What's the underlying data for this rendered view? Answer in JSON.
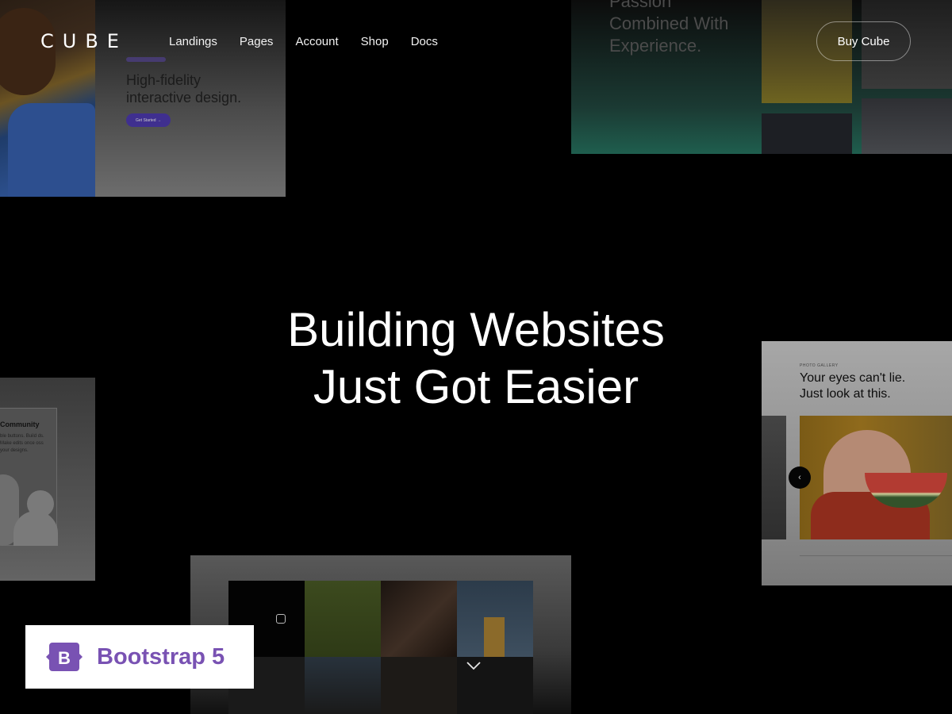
{
  "brand": {
    "logo_text": "CUBE"
  },
  "nav": {
    "links": [
      "Landings",
      "Pages",
      "Account",
      "Shop",
      "Docs"
    ],
    "cta_label": "Buy Cube"
  },
  "hero": {
    "line1": "Building Websites",
    "line2": "Just Got Easier"
  },
  "tiles": {
    "top_left": {
      "headline_1": "High-fidelity",
      "headline_2": "interactive design.",
      "button": "Get Started  →"
    },
    "top_right": {
      "line1": "Passion",
      "line2": "Combined With",
      "line3": "Experience."
    },
    "left_middle": {
      "title": "Community",
      "desc": "ble buttons. Build ds. Make edits once oss your designs."
    },
    "right_middle": {
      "kicker": "PHOTO GALLERY",
      "line1": "Your eyes can't lie.",
      "line2": "Just look at this."
    }
  },
  "badge": {
    "label": "Bootstrap 5",
    "icon": "bootstrap-logo-icon",
    "color": "#7952b3"
  },
  "colors": {
    "background": "#000000",
    "text": "#ffffff",
    "accent": "#7952b3"
  }
}
